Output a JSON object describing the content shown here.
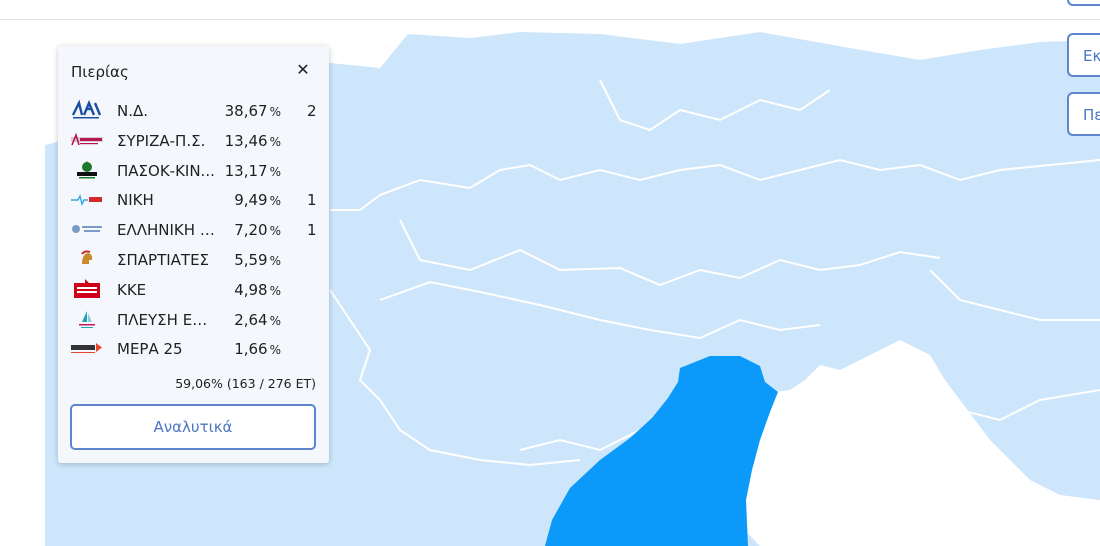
{
  "side_buttons": [
    "",
    "Εκλ",
    "Πε"
  ],
  "panel": {
    "title": "Πιερίας",
    "close_symbol": "✕",
    "parties": [
      {
        "name": "Ν.Δ.",
        "percent": "38,67",
        "unit": "%",
        "seats": "2",
        "logo": "nd-logo"
      },
      {
        "name": "ΣΥΡΙΖΑ-Π.Σ.",
        "percent": "13,46",
        "unit": "%",
        "seats": "",
        "logo": "syriza-logo"
      },
      {
        "name": "ΠΑΣΟΚ-ΚΙΝ...",
        "percent": "13,17",
        "unit": "%",
        "seats": "",
        "logo": "pasok-logo"
      },
      {
        "name": "ΝΙΚΗ",
        "percent": "9,49",
        "unit": "%",
        "seats": "1",
        "logo": "niki-logo"
      },
      {
        "name": "ΕΛΛΗΝΙΚΗ Λ...",
        "percent": "7,20",
        "unit": "%",
        "seats": "1",
        "logo": "elliniki-lysi-logo"
      },
      {
        "name": "ΣΠΑΡΤΙΑΤΕΣ",
        "percent": "5,59",
        "unit": "%",
        "seats": "",
        "logo": "spartiates-logo"
      },
      {
        "name": "ΚΚΕ",
        "percent": "4,98",
        "unit": "%",
        "seats": "",
        "logo": "kke-logo"
      },
      {
        "name": "ΠΛΕΥΣΗ ΕΛΕ...",
        "percent": "2,64",
        "unit": "%",
        "seats": "",
        "logo": "plefsi-logo"
      },
      {
        "name": "ΜΕΡΑ 25",
        "percent": "1,66",
        "unit": "%",
        "seats": "",
        "logo": "mera25-logo"
      }
    ],
    "counted_text": "59,06% (163 / 276 ΕΤ)",
    "details_label": "Αναλυτικά"
  },
  "colors": {
    "map_region": "#cde6fb",
    "map_border": "#ffffff",
    "selected_region": "#0b99fa",
    "accent": "#4a76c2"
  }
}
